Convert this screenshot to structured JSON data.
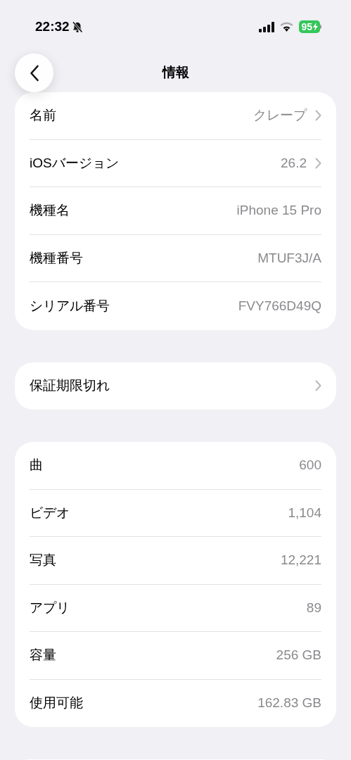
{
  "status_bar": {
    "time": "22:32",
    "silent": true,
    "battery": "95",
    "charging": true
  },
  "header": {
    "title": "情報"
  },
  "sections": [
    {
      "rows": [
        {
          "label": "名前",
          "value": "クレープ",
          "chevron": true
        },
        {
          "label": "iOSバージョン",
          "value": "26.2",
          "chevron": true
        },
        {
          "label": "機種名",
          "value": "iPhone 15 Pro",
          "chevron": false
        },
        {
          "label": "機種番号",
          "value": "MTUF3J/A",
          "chevron": false
        },
        {
          "label": "シリアル番号",
          "value": "FVY766D49Q",
          "chevron": false
        }
      ]
    },
    {
      "rows": [
        {
          "label": "保証期限切れ",
          "chevron": true
        }
      ]
    },
    {
      "rows": [
        {
          "label": "曲",
          "value": "600",
          "chevron": false
        },
        {
          "label": "ビデオ",
          "value": "1,104",
          "chevron": false
        },
        {
          "label": "写真",
          "value": "12,221",
          "chevron": false
        },
        {
          "label": "アプリ",
          "value": "89",
          "chevron": false
        },
        {
          "label": "容量",
          "value": "256 GB",
          "chevron": false
        },
        {
          "label": "使用可能",
          "value": "162.83 GB",
          "chevron": false
        }
      ]
    }
  ]
}
